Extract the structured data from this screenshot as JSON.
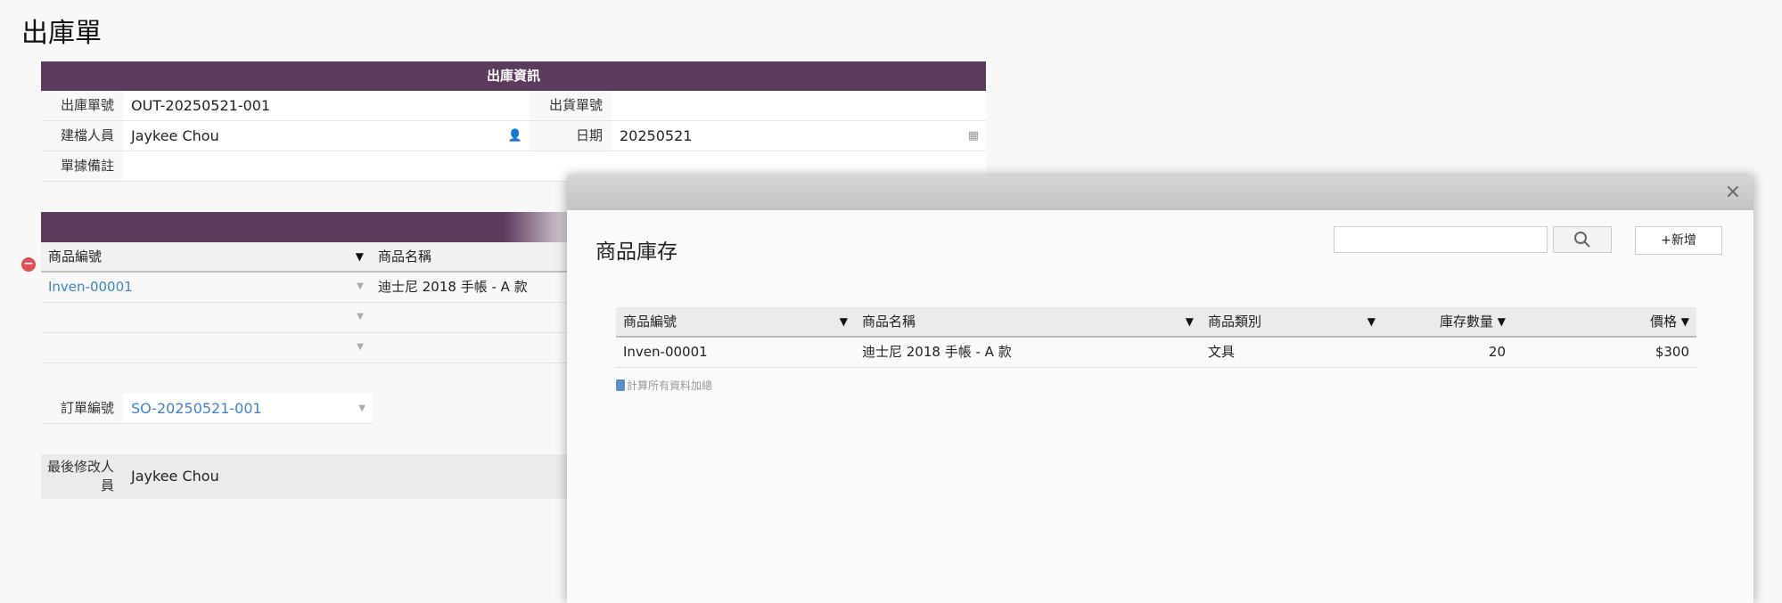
{
  "page_title": "出庫單",
  "form": {
    "section_title": "出庫資訊",
    "out_no_label": "出庫單號",
    "out_no_value": "OUT-20250521-001",
    "ship_no_label": "出貨單號",
    "ship_no_value": "",
    "creator_label": "建檔人員",
    "creator_value": "Jaykee Chou",
    "date_label": "日期",
    "date_value": "20250521",
    "note_label": "單據備註",
    "note_value": ""
  },
  "items": {
    "headers": [
      "商品編號",
      "商品名稱"
    ],
    "rows": [
      {
        "code": "Inven-00001",
        "name": "迪士尼 2018 手帳 - A 款"
      },
      {
        "code": "",
        "name": ""
      },
      {
        "code": "",
        "name": ""
      }
    ]
  },
  "order": {
    "label": "訂單編號",
    "value": "SO-20250521-001"
  },
  "modified": {
    "label": "最後修改人員",
    "value": "Jaykee Chou"
  },
  "modal": {
    "title": "商品庫存",
    "search_placeholder": "",
    "add_label": "+新增",
    "close_label": "×",
    "headers": [
      "商品編號",
      "商品名稱",
      "商品類別",
      "庫存數量",
      "價格"
    ],
    "rows": [
      {
        "code": "Inven-00001",
        "name": "迪士尼 2018 手帳 - A 款",
        "category": "文具",
        "qty": "20",
        "price": "$300"
      }
    ],
    "calc_label": "計算所有資料加總"
  },
  "colors": {
    "header_bg": "#5c3a5c",
    "link": "#3d85c6"
  }
}
